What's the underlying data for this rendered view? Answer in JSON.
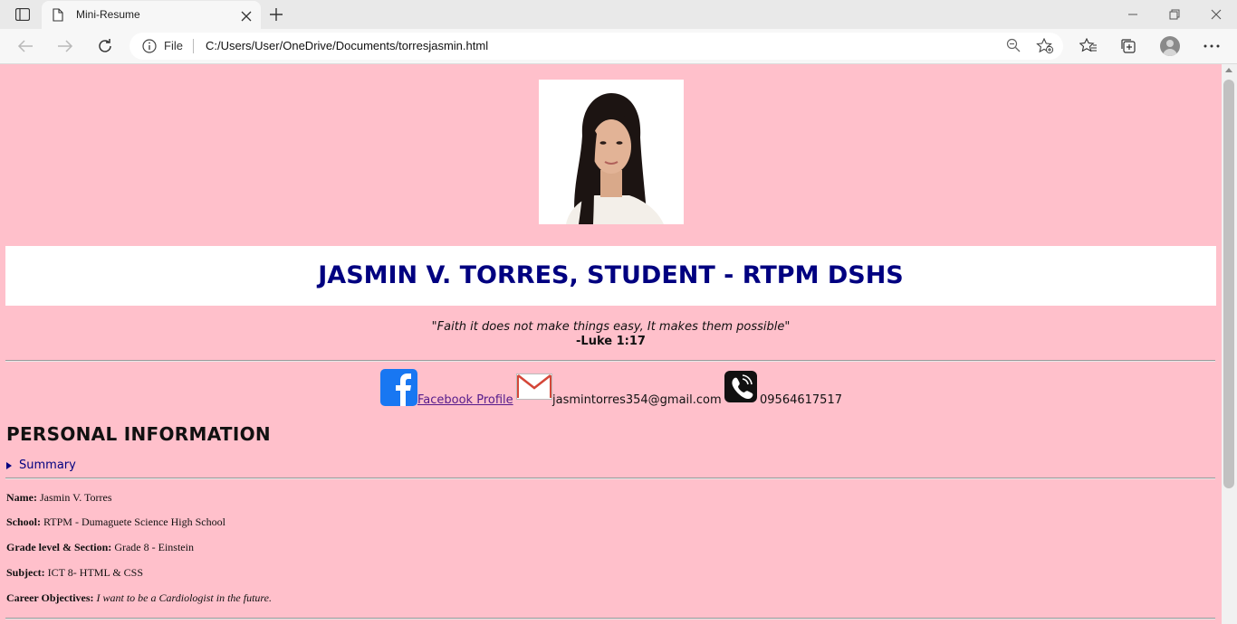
{
  "browser": {
    "tab_title": "Mini-Resume",
    "address_prefix": "File",
    "url": "C:/Users/User/OneDrive/Documents/torresjasmin.html"
  },
  "header": {
    "name_title": "JASMIN V. TORRES, STUDENT - RTPM DSHS",
    "quote": "\"Faith it does not make things easy, It makes them possible\"",
    "verse": "-Luke 1:17"
  },
  "contacts": {
    "facebook_label": "Facebook Profile ",
    "email": "jasmintorres354@gmail.com",
    "phone": "09564617517"
  },
  "personal": {
    "heading": "PERSONAL INFORMATION",
    "summary_label": "Summary",
    "fields": [
      {
        "label": "Name:",
        "value": "Jasmin V. Torres"
      },
      {
        "label": "School:",
        "value": "RTPM - Dumaguete Science High School"
      },
      {
        "label": "Grade level & Section:",
        "value": "Grade 8 - Einstein"
      },
      {
        "label": "Subject:",
        "value": "ICT 8- HTML & CSS"
      },
      {
        "label": "Career Objectives:",
        "value": "I want to be a Cardiologist in the future."
      }
    ]
  },
  "colors": {
    "page_background": "#ffc0cb",
    "title_color": "#000080",
    "facebook_blue": "#1877f2"
  }
}
